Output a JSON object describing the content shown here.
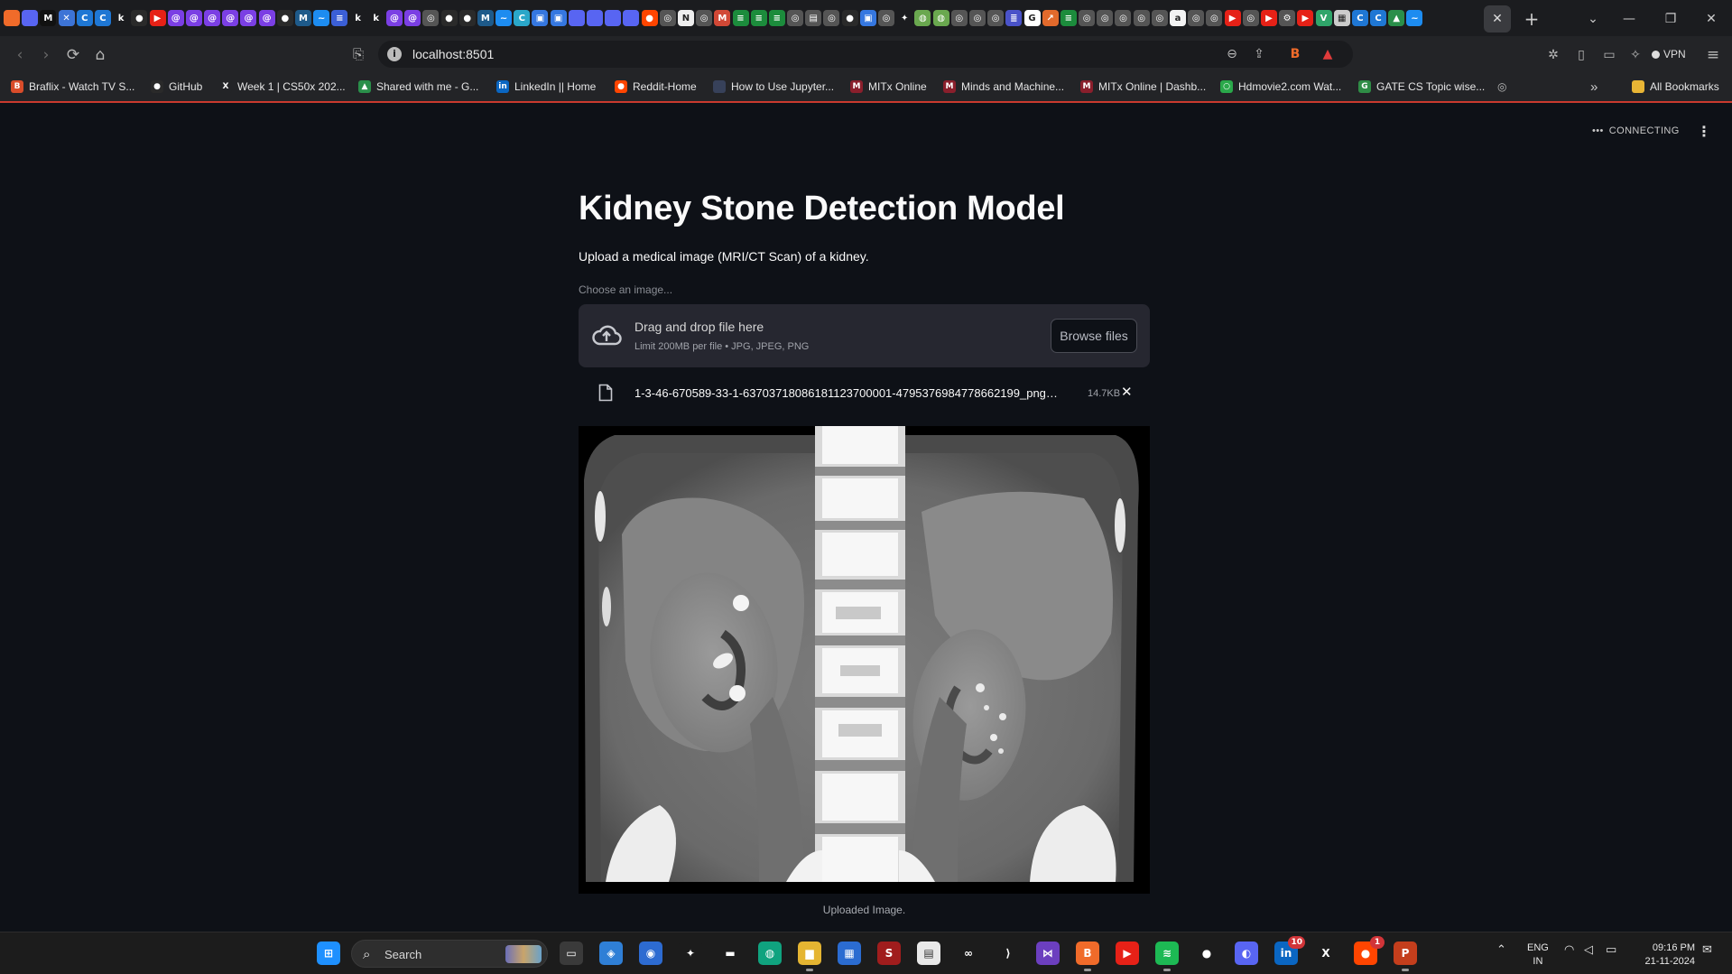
{
  "tabs": {
    "favicons": [
      {
        "icon": "brave-lion-icon",
        "color": "#f06b2a",
        "glyph": ""
      },
      {
        "icon": "discord-icon",
        "color": "#5865f2",
        "glyph": ""
      },
      {
        "icon": "medium-icon",
        "color": "#111111",
        "glyph": "M"
      },
      {
        "icon": "x-square-icon",
        "color": "#3d74d6",
        "glyph": "✕"
      },
      {
        "icon": "c-icon",
        "color": "#1f77d4",
        "glyph": "C"
      },
      {
        "icon": "c-icon",
        "color": "#1f77d4",
        "glyph": "C"
      },
      {
        "icon": "k-icon",
        "color": "#1b1c1f",
        "glyph": "k"
      },
      {
        "icon": "github-icon",
        "color": "#2a2a2a",
        "glyph": "●"
      },
      {
        "icon": "youtube-icon",
        "color": "#e62117",
        "glyph": "▶"
      },
      {
        "icon": "swirl-icon",
        "color": "#7b3fe4",
        "glyph": "@"
      },
      {
        "icon": "swirl-icon",
        "color": "#7b3fe4",
        "glyph": "@"
      },
      {
        "icon": "swirl-icon",
        "color": "#7b3fe4",
        "glyph": "@"
      },
      {
        "icon": "swirl-icon",
        "color": "#7b3fe4",
        "glyph": "@"
      },
      {
        "icon": "swirl-icon",
        "color": "#7b3fe4",
        "glyph": "@"
      },
      {
        "icon": "swirl-icon",
        "color": "#7b3fe4",
        "glyph": "@"
      },
      {
        "icon": "github-icon",
        "color": "#2a2a2a",
        "glyph": "●"
      },
      {
        "icon": "m-icon",
        "color": "#1e5a8a",
        "glyph": "M"
      },
      {
        "icon": "bluesky-icon",
        "color": "#1d8cf0",
        "glyph": "~"
      },
      {
        "icon": "doc-icon",
        "color": "#3b5fd6",
        "glyph": "≡"
      },
      {
        "icon": "k-icon",
        "color": "#1b1c1f",
        "glyph": "k"
      },
      {
        "icon": "k-icon",
        "color": "#1b1c1f",
        "glyph": "k"
      },
      {
        "icon": "swirl-icon",
        "color": "#7b3fe4",
        "glyph": "@"
      },
      {
        "icon": "swirl-icon",
        "color": "#7b3fe4",
        "glyph": "@"
      },
      {
        "icon": "globe-icon",
        "color": "#555555",
        "glyph": "◎"
      },
      {
        "icon": "github-icon",
        "color": "#2a2a2a",
        "glyph": "●"
      },
      {
        "icon": "github-icon",
        "color": "#2a2a2a",
        "glyph": "●"
      },
      {
        "icon": "m-icon",
        "color": "#1e5a8a",
        "glyph": "M"
      },
      {
        "icon": "bluesky-icon",
        "color": "#1d8cf0",
        "glyph": "~"
      },
      {
        "icon": "c-icon",
        "color": "#2aa7c9",
        "glyph": "C"
      },
      {
        "icon": "image-icon",
        "color": "#3577e0",
        "glyph": "▣"
      },
      {
        "icon": "image-icon",
        "color": "#3577e0",
        "glyph": "▣"
      },
      {
        "icon": "discord-icon",
        "color": "#5865f2",
        "glyph": ""
      },
      {
        "icon": "discord-icon",
        "color": "#5865f2",
        "glyph": ""
      },
      {
        "icon": "discord-icon",
        "color": "#5865f2",
        "glyph": ""
      },
      {
        "icon": "discord-icon",
        "color": "#5865f2",
        "glyph": ""
      },
      {
        "icon": "reddit-icon",
        "color": "#ff4500",
        "glyph": "●"
      },
      {
        "icon": "globe-icon",
        "color": "#555555",
        "glyph": "◎"
      },
      {
        "icon": "notion-icon",
        "color": "#eeeeee",
        "glyph": "N"
      },
      {
        "icon": "globe-icon",
        "color": "#555555",
        "glyph": "◎"
      },
      {
        "icon": "gmail-icon",
        "color": "#d14836",
        "glyph": "M"
      },
      {
        "icon": "hbars-icon",
        "color": "#1c8c3c",
        "glyph": "≡"
      },
      {
        "icon": "hbars-icon",
        "color": "#1c8c3c",
        "glyph": "≡"
      },
      {
        "icon": "hbars-icon",
        "color": "#1c8c3c",
        "glyph": "≡"
      },
      {
        "icon": "globe-icon",
        "color": "#555555",
        "glyph": "◎"
      },
      {
        "icon": "mfx-icon",
        "color": "#555555",
        "glyph": "▤"
      },
      {
        "icon": "globe-icon",
        "color": "#555555",
        "glyph": "◎"
      },
      {
        "icon": "github-icon",
        "color": "#2a2a2a",
        "glyph": "●"
      },
      {
        "icon": "image-icon",
        "color": "#3577e0",
        "glyph": "▣"
      },
      {
        "icon": "globe-icon",
        "color": "#555555",
        "glyph": "◎"
      },
      {
        "icon": "sparkle-icon",
        "color": "#1b1c1f",
        "glyph": "✦"
      },
      {
        "icon": "chatgpt-icon",
        "color": "#6aa84f",
        "glyph": "◍"
      },
      {
        "icon": "chatgpt-icon",
        "color": "#6aa84f",
        "glyph": "◍"
      },
      {
        "icon": "globe-icon",
        "color": "#555555",
        "glyph": "◎"
      },
      {
        "icon": "globe-icon",
        "color": "#555555",
        "glyph": "◎"
      },
      {
        "icon": "globe-icon",
        "color": "#555555",
        "glyph": "◎"
      },
      {
        "icon": "list-icon",
        "color": "#4a53c9",
        "glyph": "≣"
      },
      {
        "icon": "google-icon",
        "color": "#ffffff",
        "glyph": "G"
      },
      {
        "icon": "arrow-icon",
        "color": "#e26a2c",
        "glyph": "↗"
      },
      {
        "icon": "hbars-icon",
        "color": "#1c8c3c",
        "glyph": "≡"
      },
      {
        "icon": "globe-icon",
        "color": "#555555",
        "glyph": "◎"
      },
      {
        "icon": "globe-icon",
        "color": "#555555",
        "glyph": "◎"
      },
      {
        "icon": "globe-icon",
        "color": "#555555",
        "glyph": "◎"
      },
      {
        "icon": "globe-icon",
        "color": "#555555",
        "glyph": "◎"
      },
      {
        "icon": "globe-icon",
        "color": "#555555",
        "glyph": "◎"
      },
      {
        "icon": "amazon-icon",
        "color": "#f3f3f3",
        "glyph": "a"
      },
      {
        "icon": "globe-icon",
        "color": "#555555",
        "glyph": "◎"
      },
      {
        "icon": "globe-icon",
        "color": "#555555",
        "glyph": "◎"
      },
      {
        "icon": "youtube-icon",
        "color": "#e62117",
        "glyph": "▶"
      },
      {
        "icon": "globe-icon",
        "color": "#555555",
        "glyph": "◎"
      },
      {
        "icon": "youtube-icon",
        "color": "#e62117",
        "glyph": "▶"
      },
      {
        "icon": "gear-icon",
        "color": "#555555",
        "glyph": "⚙"
      },
      {
        "icon": "youtube-icon",
        "color": "#e62117",
        "glyph": "▶"
      },
      {
        "icon": "vue-icon",
        "color": "#2fa56a",
        "glyph": "V"
      },
      {
        "icon": "sheet-icon",
        "color": "#cccccc",
        "glyph": "▦"
      },
      {
        "icon": "c-icon",
        "color": "#1f77d4",
        "glyph": "C"
      },
      {
        "icon": "c-icon",
        "color": "#1f77d4",
        "glyph": "C"
      },
      {
        "icon": "drive-icon",
        "color": "#2a8f4a",
        "glyph": "▲"
      },
      {
        "icon": "bluesky-icon",
        "color": "#1d8cf0",
        "glyph": "~"
      }
    ],
    "active_tab_close": "✕",
    "new_tab": "+",
    "tab_search": "⌄",
    "minimize": "—",
    "restore": "❐",
    "close_window": "✕"
  },
  "toolbar": {
    "back_icon": "‹",
    "forward_icon": "›",
    "reload_icon": "⟳",
    "home_icon": "⌂",
    "bookmark_icon": "⎘",
    "url": "localhost:8501",
    "zoom_icon": "⊖",
    "share_icon": "⇪",
    "brave_shield_icon": "B",
    "brave_rewards_icon": "▲",
    "extensions_icon": "✲",
    "sidebar_icon": "▯",
    "wallet_icon": "▭",
    "leo_icon": "✧",
    "vpn_label": "VPN",
    "menu_icon": "≡"
  },
  "bookmarks": [
    {
      "label": "Braflix - Watch TV S...",
      "icon": "braflix-icon",
      "color": "#d94c2a",
      "glyph": "B"
    },
    {
      "label": "GitHub",
      "icon": "github-icon",
      "color": "#2a2a2a",
      "glyph": "●"
    },
    {
      "label": "Week 1 | CS50x 202...",
      "icon": "x-icon",
      "color": "#232427",
      "glyph": "X"
    },
    {
      "label": "Shared with me - G...",
      "icon": "drive-icon",
      "color": "#2a8f4a",
      "glyph": "▲"
    },
    {
      "label": "LinkedIn || Home",
      "icon": "linkedin-icon",
      "color": "#0a66c2",
      "glyph": "in"
    },
    {
      "label": "Reddit-Home",
      "icon": "reddit-icon",
      "color": "#ff4500",
      "glyph": "●"
    },
    {
      "label": "How to Use Jupyter...",
      "icon": "page-icon",
      "color": "#37415a",
      "glyph": ""
    },
    {
      "label": "MITx Online",
      "icon": "mit-icon",
      "color": "#8a1f2c",
      "glyph": "M"
    },
    {
      "label": "Minds and Machine...",
      "icon": "mit-icon",
      "color": "#8a1f2c",
      "glyph": "M"
    },
    {
      "label": "MITx Online | Dashb...",
      "icon": "mit-icon",
      "color": "#8a1f2c",
      "glyph": "M"
    },
    {
      "label": "Hdmovie2.com Wat...",
      "icon": "hdmovie-icon",
      "color": "#2aa84a",
      "glyph": "○"
    },
    {
      "label": "GATE CS Topic wise...",
      "icon": "gfg-icon",
      "color": "#2f8d46",
      "glyph": "G"
    }
  ],
  "bookmarks_extra_icon": "◎",
  "bookmarks_overflow": "»",
  "all_bookmarks": "All Bookmarks",
  "app": {
    "status": "CONNECTING",
    "status_icon": "•••",
    "menu_icon": "⋮",
    "title": "Kidney Stone Detection Model",
    "subtitle": "Upload a medical image (MRI/CT Scan) of a kidney.",
    "uploader_label": "Choose an image...",
    "dropzone_text": "Drag and drop file here",
    "dropzone_limit": "Limit 200MB per file • JPG, JPEG, PNG",
    "browse_button": "Browse files",
    "file_name": "1-3-46-670589-33-1-63703718086181123700001-4795376984778662199_png_jpg...",
    "file_size": "14.7KB",
    "remove_file_icon": "✕",
    "image_caption": "Uploaded Image."
  },
  "taskbar": {
    "search_label": "Search",
    "apps": [
      {
        "name": "windows-start-icon",
        "color": "#1e90ff",
        "glyph": "⊞",
        "open": false,
        "badge": ""
      },
      {
        "name": "task-view-icon",
        "color": "#3a3a3a",
        "glyph": "▭",
        "open": false,
        "badge": ""
      },
      {
        "name": "copilot-icon",
        "color": "#2f7fd6",
        "glyph": "◈",
        "open": false,
        "badge": ""
      },
      {
        "name": "power-automate-icon",
        "color": "#2d6bd1",
        "glyph": "◉",
        "open": false,
        "badge": ""
      },
      {
        "name": "gemini-icon",
        "color": "#1c1c1c",
        "glyph": "✦",
        "open": false,
        "badge": ""
      },
      {
        "name": "widget-bar-icon",
        "color": "#1c1c1c",
        "glyph": "▬",
        "open": false,
        "badge": ""
      },
      {
        "name": "chatgpt-icon",
        "color": "#10a37f",
        "glyph": "◍",
        "open": false,
        "badge": ""
      },
      {
        "name": "file-explorer-icon",
        "color": "#e5b532",
        "glyph": "▆",
        "open": true,
        "badge": ""
      },
      {
        "name": "ms-store-icon",
        "color": "#2b6cd1",
        "glyph": "▦",
        "open": false,
        "badge": ""
      },
      {
        "name": "stack-icon",
        "color": "#a01d1d",
        "glyph": "S",
        "open": false,
        "badge": ""
      },
      {
        "name": "document-icon",
        "color": "#e8e8e8",
        "glyph": "▤",
        "open": false,
        "badge": ""
      },
      {
        "name": "infinity-icon",
        "color": "#1c1c1c",
        "glyph": "∞",
        "open": false,
        "badge": ""
      },
      {
        "name": "vscode-icon",
        "color": "#1c1c1c",
        "glyph": "⟩",
        "open": false,
        "badge": ""
      },
      {
        "name": "visual-studio-icon",
        "color": "#6c3fbf",
        "glyph": "⋈",
        "open": false,
        "badge": ""
      },
      {
        "name": "brave-browser-icon",
        "color": "#f06b2a",
        "glyph": "B",
        "open": true,
        "badge": ""
      },
      {
        "name": "youtube-icon",
        "color": "#e62117",
        "glyph": "▶",
        "open": false,
        "badge": ""
      },
      {
        "name": "spotify-icon",
        "color": "#1db954",
        "glyph": "≋",
        "open": true,
        "badge": ""
      },
      {
        "name": "github-icon",
        "color": "#1c1c1c",
        "glyph": "●",
        "open": false,
        "badge": ""
      },
      {
        "name": "discord-icon",
        "color": "#5865f2",
        "glyph": "◐",
        "open": false,
        "badge": ""
      },
      {
        "name": "linkedin-icon",
        "color": "#0a66c2",
        "glyph": "in",
        "open": false,
        "badge": "10"
      },
      {
        "name": "x-icon",
        "color": "#1c1c1c",
        "glyph": "X",
        "open": false,
        "badge": ""
      },
      {
        "name": "reddit-icon",
        "color": "#ff4500",
        "glyph": "●",
        "open": false,
        "badge": "1"
      },
      {
        "name": "powerpoint-icon",
        "color": "#c43e1c",
        "glyph": "P",
        "open": true,
        "badge": ""
      }
    ],
    "tray_chevron": "⌃",
    "lang_top": "ENG",
    "lang_bottom": "IN",
    "wifi_icon": "◠",
    "volume_icon": "◁",
    "battery_icon": "▭",
    "time": "09:16 PM",
    "date": "21-11-2024",
    "notification_icon": "✉"
  }
}
